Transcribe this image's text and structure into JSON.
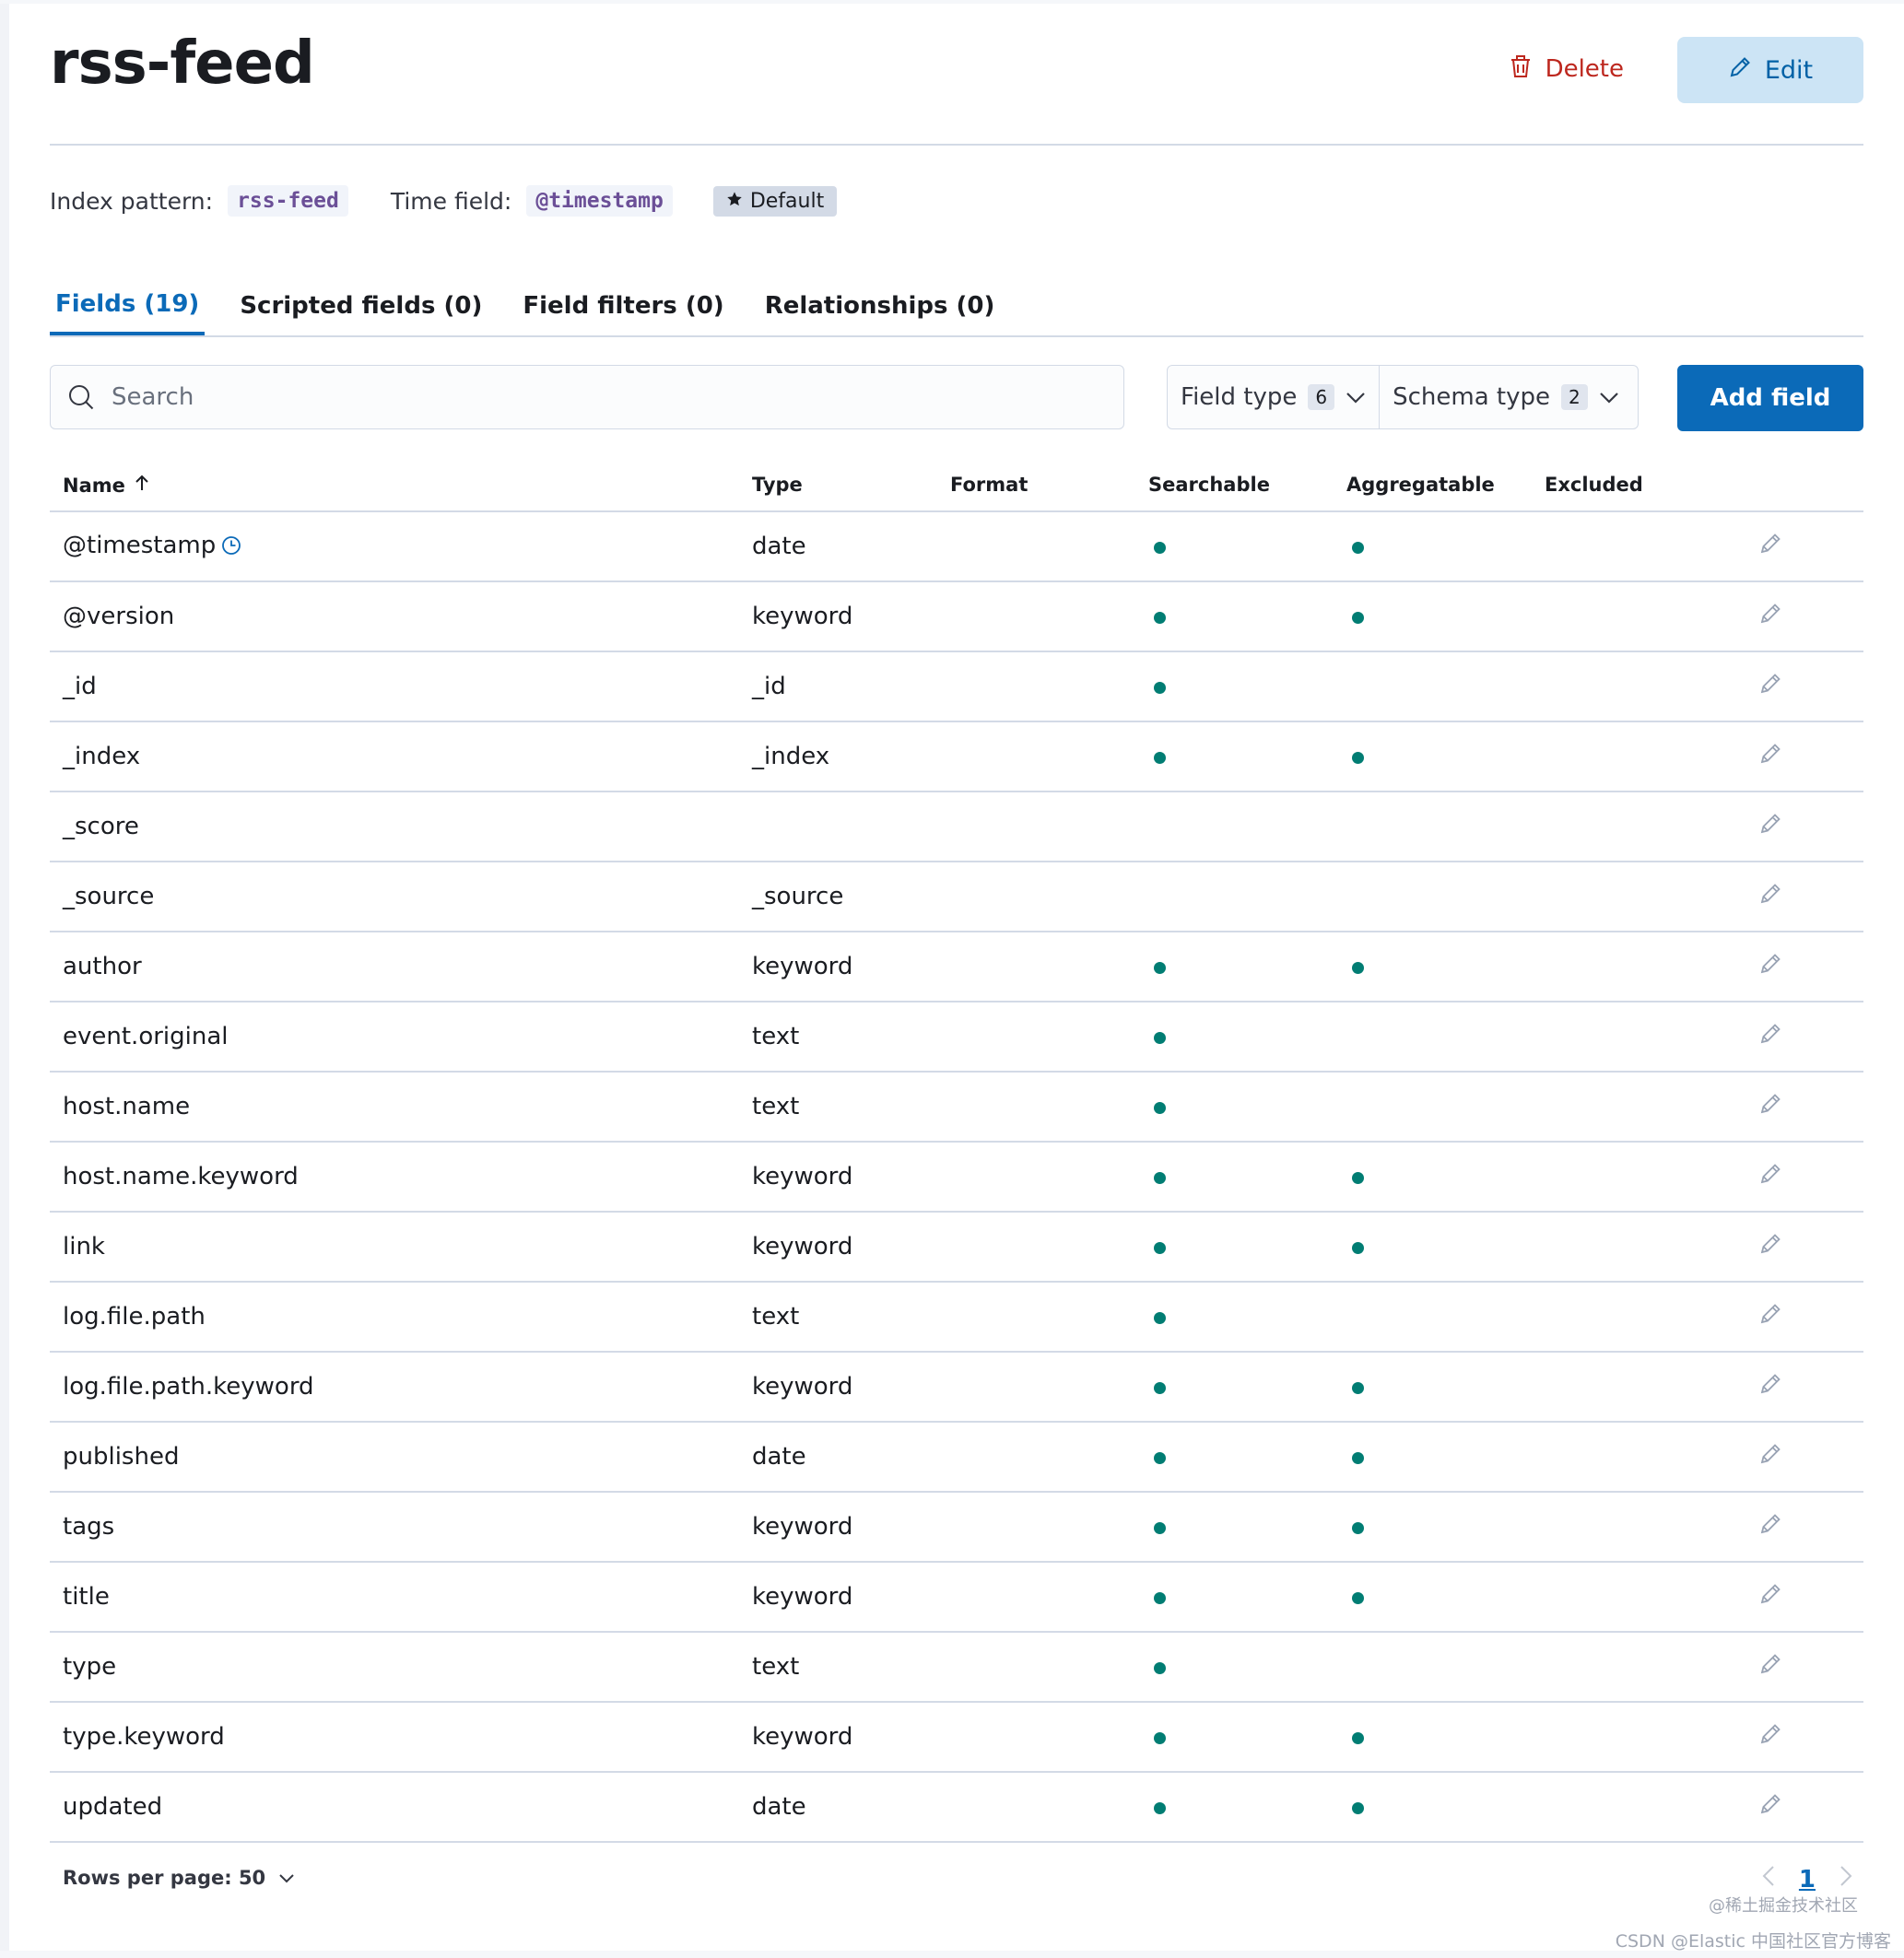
{
  "header": {
    "title": "rss-feed",
    "delete_label": "Delete",
    "edit_label": "Edit"
  },
  "meta": {
    "index_pattern_label": "Index pattern:",
    "index_pattern_value": "rss-feed",
    "time_field_label": "Time field:",
    "time_field_value": "@timestamp",
    "default_badge": "Default"
  },
  "tabs": [
    {
      "label": "Fields (19)",
      "active": true
    },
    {
      "label": "Scripted fields (0)",
      "active": false
    },
    {
      "label": "Field filters (0)",
      "active": false
    },
    {
      "label": "Relationships (0)",
      "active": false
    }
  ],
  "toolbar": {
    "search_placeholder": "Search",
    "field_type_label": "Field type",
    "field_type_count": "6",
    "schema_type_label": "Schema type",
    "schema_type_count": "2",
    "add_field_label": "Add field"
  },
  "table": {
    "columns": [
      "Name",
      "Type",
      "Format",
      "Searchable",
      "Aggregatable",
      "Excluded"
    ],
    "rows": [
      {
        "name": "@timestamp",
        "type": "date",
        "format": "",
        "searchable": true,
        "aggregatable": true,
        "excluded": false,
        "time_icon": true
      },
      {
        "name": "@version",
        "type": "keyword",
        "format": "",
        "searchable": true,
        "aggregatable": true,
        "excluded": false
      },
      {
        "name": "_id",
        "type": "_id",
        "format": "",
        "searchable": true,
        "aggregatable": false,
        "excluded": false
      },
      {
        "name": "_index",
        "type": "_index",
        "format": "",
        "searchable": true,
        "aggregatable": true,
        "excluded": false
      },
      {
        "name": "_score",
        "type": "",
        "format": "",
        "searchable": false,
        "aggregatable": false,
        "excluded": false
      },
      {
        "name": "_source",
        "type": "_source",
        "format": "",
        "searchable": false,
        "aggregatable": false,
        "excluded": false
      },
      {
        "name": "author",
        "type": "keyword",
        "format": "",
        "searchable": true,
        "aggregatable": true,
        "excluded": false
      },
      {
        "name": "event.original",
        "type": "text",
        "format": "",
        "searchable": true,
        "aggregatable": false,
        "excluded": false
      },
      {
        "name": "host.name",
        "type": "text",
        "format": "",
        "searchable": true,
        "aggregatable": false,
        "excluded": false
      },
      {
        "name": "host.name.keyword",
        "type": "keyword",
        "format": "",
        "searchable": true,
        "aggregatable": true,
        "excluded": false
      },
      {
        "name": "link",
        "type": "keyword",
        "format": "",
        "searchable": true,
        "aggregatable": true,
        "excluded": false
      },
      {
        "name": "log.file.path",
        "type": "text",
        "format": "",
        "searchable": true,
        "aggregatable": false,
        "excluded": false
      },
      {
        "name": "log.file.path.keyword",
        "type": "keyword",
        "format": "",
        "searchable": true,
        "aggregatable": true,
        "excluded": false
      },
      {
        "name": "published",
        "type": "date",
        "format": "",
        "searchable": true,
        "aggregatable": true,
        "excluded": false
      },
      {
        "name": "tags",
        "type": "keyword",
        "format": "",
        "searchable": true,
        "aggregatable": true,
        "excluded": false
      },
      {
        "name": "title",
        "type": "keyword",
        "format": "",
        "searchable": true,
        "aggregatable": true,
        "excluded": false
      },
      {
        "name": "type",
        "type": "text",
        "format": "",
        "searchable": true,
        "aggregatable": false,
        "excluded": false
      },
      {
        "name": "type.keyword",
        "type": "keyword",
        "format": "",
        "searchable": true,
        "aggregatable": true,
        "excluded": false
      },
      {
        "name": "updated",
        "type": "date",
        "format": "",
        "searchable": true,
        "aggregatable": true,
        "excluded": false
      }
    ]
  },
  "footer": {
    "rows_per_page": "Rows per page: 50",
    "current_page": "1"
  },
  "watermarks": {
    "line1": "@稀土掘金技术社区",
    "line2": "CSDN @Elastic 中国社区官方博客"
  },
  "colors": {
    "primary": "#0b6ab8",
    "danger": "#bd271e",
    "dot": "#017d73",
    "border": "#d3dae6"
  },
  "icons": {
    "delete": "trash-icon",
    "edit": "pencil-icon",
    "default": "star-icon",
    "search": "search-icon",
    "sort": "arrow-up-icon",
    "time": "clock-icon",
    "row_edit": "pencil-icon",
    "chevron": "chevron-down-icon"
  }
}
